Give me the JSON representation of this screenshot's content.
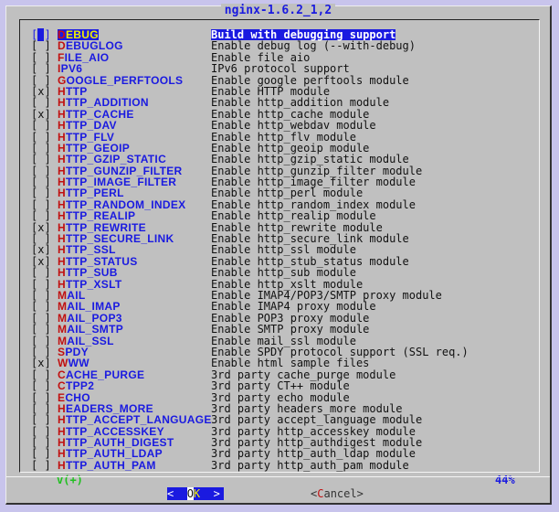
{
  "title": "nginx-1.6.2_1,2",
  "options": [
    {
      "checked": false,
      "name": "DEBUG",
      "desc": "Build with debugging support",
      "selected": true
    },
    {
      "checked": false,
      "name": "DEBUGLOG",
      "desc": "Enable debug log (--with-debug)"
    },
    {
      "checked": false,
      "name": "FILE_AIO",
      "desc": "Enable file aio"
    },
    {
      "checked": false,
      "name": "IPV6",
      "desc": "IPv6 protocol support"
    },
    {
      "checked": false,
      "name": "GOOGLE_PERFTOOLS",
      "desc": "Enable google perftools module"
    },
    {
      "checked": true,
      "name": "HTTP",
      "desc": "Enable HTTP module"
    },
    {
      "checked": false,
      "name": "HTTP_ADDITION",
      "desc": "Enable http_addition module"
    },
    {
      "checked": true,
      "name": "HTTP_CACHE",
      "desc": "Enable http_cache module"
    },
    {
      "checked": false,
      "name": "HTTP_DAV",
      "desc": "Enable http_webdav module"
    },
    {
      "checked": false,
      "name": "HTTP_FLV",
      "desc": "Enable http_flv module"
    },
    {
      "checked": false,
      "name": "HTTP_GEOIP",
      "desc": "Enable http_geoip module"
    },
    {
      "checked": false,
      "name": "HTTP_GZIP_STATIC",
      "desc": "Enable http_gzip_static module"
    },
    {
      "checked": false,
      "name": "HTTP_GUNZIP_FILTER",
      "desc": "Enable http_gunzip_filter module"
    },
    {
      "checked": false,
      "name": "HTTP_IMAGE_FILTER",
      "desc": "Enable http_image_filter module"
    },
    {
      "checked": false,
      "name": "HTTP_PERL",
      "desc": "Enable http_perl module"
    },
    {
      "checked": false,
      "name": "HTTP_RANDOM_INDEX",
      "desc": "Enable http_random_index module"
    },
    {
      "checked": false,
      "name": "HTTP_REALIP",
      "desc": "Enable http_realip module"
    },
    {
      "checked": true,
      "name": "HTTP_REWRITE",
      "desc": "Enable http_rewrite module"
    },
    {
      "checked": false,
      "name": "HTTP_SECURE_LINK",
      "desc": "Enable http_secure_link module"
    },
    {
      "checked": true,
      "name": "HTTP_SSL",
      "desc": "Enable http_ssl module"
    },
    {
      "checked": true,
      "name": "HTTP_STATUS",
      "desc": "Enable http_stub_status module"
    },
    {
      "checked": false,
      "name": "HTTP_SUB",
      "desc": "Enable http_sub module"
    },
    {
      "checked": false,
      "name": "HTTP_XSLT",
      "desc": "Enable http_xslt module"
    },
    {
      "checked": false,
      "name": "MAIL",
      "desc": "Enable IMAP4/POP3/SMTP proxy module"
    },
    {
      "checked": false,
      "name": "MAIL_IMAP",
      "desc": "Enable IMAP4 proxy module"
    },
    {
      "checked": false,
      "name": "MAIL_POP3",
      "desc": "Enable POP3 proxy module"
    },
    {
      "checked": false,
      "name": "MAIL_SMTP",
      "desc": "Enable SMTP proxy module"
    },
    {
      "checked": false,
      "name": "MAIL_SSL",
      "desc": "Enable mail_ssl module"
    },
    {
      "checked": false,
      "name": "SPDY",
      "desc": "Enable SPDY protocol support (SSL req.)"
    },
    {
      "checked": true,
      "name": "WWW",
      "desc": "Enable html sample files"
    },
    {
      "checked": false,
      "name": "CACHE_PURGE",
      "desc": "3rd party cache_purge module"
    },
    {
      "checked": false,
      "name": "CTPP2",
      "desc": "3rd party CT++ module"
    },
    {
      "checked": false,
      "name": "ECHO",
      "desc": "3rd party echo module"
    },
    {
      "checked": false,
      "name": "HEADERS_MORE",
      "desc": "3rd party headers_more module"
    },
    {
      "checked": false,
      "name": "HTTP_ACCEPT_LANGUAGE",
      "desc": "3rd party accept_language module"
    },
    {
      "checked": false,
      "name": "HTTP_ACCESSKEY",
      "desc": "3rd party http_accesskey module"
    },
    {
      "checked": false,
      "name": "HTTP_AUTH_DIGEST",
      "desc": "3rd party http_authdigest module"
    },
    {
      "checked": false,
      "name": "HTTP_AUTH_LDAP",
      "desc": "3rd party http_auth_ldap module"
    },
    {
      "checked": false,
      "name": "HTTP_AUTH_PAM",
      "desc": "3rd party http_auth_pam module"
    }
  ],
  "scroll_indicator": "v(+)",
  "scroll_percent": "44%",
  "buttons": {
    "ok": "OK",
    "cancel": "Cancel"
  },
  "colors": {
    "accent": "#1a1ae0",
    "hotkey": "#c01010",
    "background": "#c0c0c0"
  }
}
